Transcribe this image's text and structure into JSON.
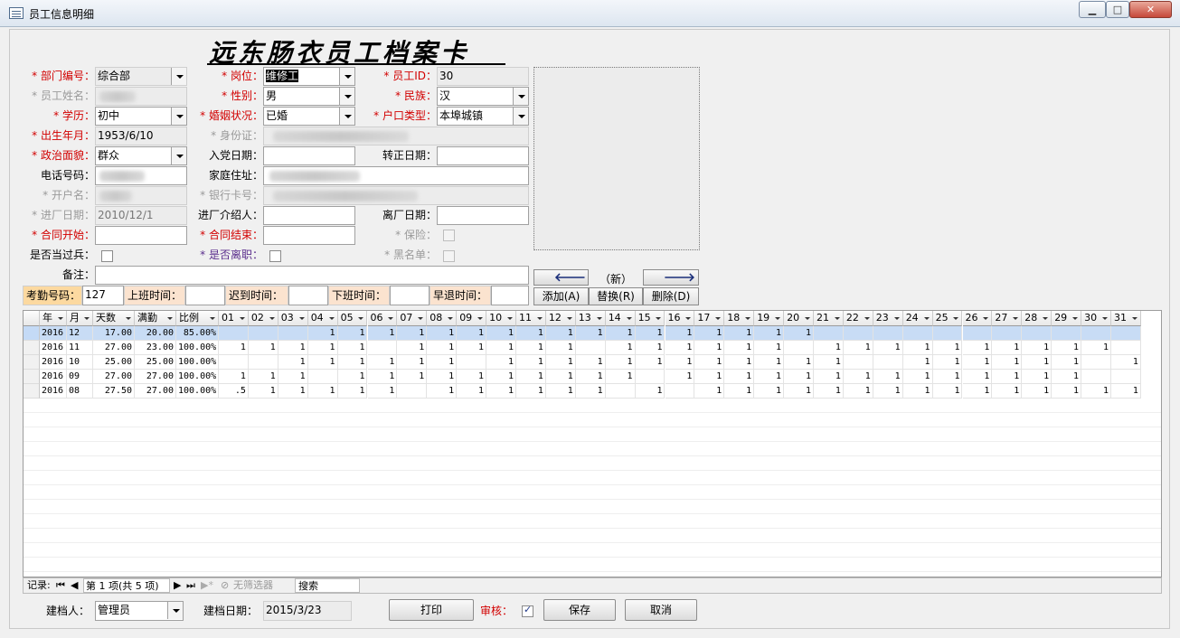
{
  "window": {
    "title": "员工信息明细",
    "min": "▁",
    "max": "□",
    "close": "✕"
  },
  "form_title": "远东肠衣员工档案卡",
  "fields": {
    "dept": {
      "label": "* 部门编号：",
      "value": "综合部"
    },
    "position": {
      "label": "* 岗位：",
      "value": "维修工"
    },
    "emp_id": {
      "label": "* 员工ID：",
      "value": "30"
    },
    "name": {
      "label": "* 员工姓名："
    },
    "gender": {
      "label": "* 性别：",
      "value": "男"
    },
    "ethnic": {
      "label": "* 民族：",
      "value": "汉"
    },
    "edu": {
      "label": "* 学历：",
      "value": "初中"
    },
    "marital": {
      "label": "* 婚姻状况：",
      "value": "已婚"
    },
    "hukou": {
      "label": "* 户口类型：",
      "value": "本埠城镇"
    },
    "birth": {
      "label": "* 出生年月：",
      "value": "1953/6/10"
    },
    "idcard": {
      "label": "* 身份证："
    },
    "politics": {
      "label": "* 政治面貌：",
      "value": "群众"
    },
    "party_date": {
      "label": "入党日期：",
      "value": ""
    },
    "regular_date": {
      "label": "转正日期：",
      "value": ""
    },
    "phone": {
      "label": "电话号码："
    },
    "address": {
      "label": "家庭住址："
    },
    "account_name": {
      "label": "* 开户名："
    },
    "bank_card": {
      "label": "* 银行卡号："
    },
    "entry_date": {
      "label": "* 进厂日期：",
      "value": "2010/12/1"
    },
    "referrer": {
      "label": "进厂介绍人：",
      "value": ""
    },
    "leave_date": {
      "label": "离厂日期：",
      "value": ""
    },
    "contract_start": {
      "label": "* 合同开始：",
      "value": ""
    },
    "contract_end": {
      "label": "* 合同结束：",
      "value": ""
    },
    "insurance": {
      "label": "* 保险："
    },
    "soldier": {
      "label": "是否当过兵："
    },
    "resigned": {
      "label": "* 是否离职："
    },
    "blacklist": {
      "label": "* 黑名单："
    },
    "remark": {
      "label": "备注：",
      "value": ""
    }
  },
  "attendance": {
    "code_label": "考勤号码：",
    "code_value": "127",
    "on_label": "上班时间：",
    "late_label": "迟到时间：",
    "off_label": "下班时间：",
    "early_label": "早退时间："
  },
  "photo_nav": {
    "prev": "🡐",
    "new_label": "（新）",
    "next": "🡒",
    "add": "添加(A)",
    "replace": "替换(R)",
    "delete": "删除(D)"
  },
  "table": {
    "headers": [
      "年",
      "月",
      "天数",
      "满勤",
      "比例",
      "01",
      "02",
      "03",
      "04",
      "05",
      "06",
      "07",
      "08",
      "09",
      "10",
      "11",
      "12",
      "13",
      "14",
      "15",
      "16",
      "17",
      "18",
      "19",
      "20",
      "21",
      "22",
      "23",
      "24",
      "25",
      "26",
      "27",
      "28",
      "29",
      "30",
      "31"
    ],
    "rows": [
      [
        "2016",
        "12",
        "17.00",
        "20.00",
        "85.00%",
        "",
        "",
        "",
        "1",
        "1",
        "1",
        "1",
        "1",
        "1",
        "1",
        "1",
        "1",
        "1",
        "1",
        "1",
        "1",
        "1",
        "1",
        "1",
        "1",
        "",
        "",
        "",
        "",
        "",
        "",
        "",
        "",
        "",
        "",
        ""
      ],
      [
        "2016",
        "11",
        "27.00",
        "23.00",
        "100.00%",
        "1",
        "1",
        "1",
        "1",
        "1",
        "",
        "1",
        "1",
        "1",
        "1",
        "1",
        "1",
        "",
        "1",
        "1",
        "1",
        "1",
        "1",
        "1",
        "",
        "1",
        "1",
        "1",
        "1",
        "1",
        "1",
        "1",
        "1",
        "1",
        "1",
        ""
      ],
      [
        "2016",
        "10",
        "25.00",
        "25.00",
        "100.00%",
        "",
        "",
        "1",
        "1",
        "1",
        "1",
        "1",
        "1",
        "",
        "1",
        "1",
        "1",
        "1",
        "1",
        "1",
        "1",
        "1",
        "1",
        "1",
        "1",
        "1",
        "",
        "",
        "1",
        "1",
        "1",
        "1",
        "1",
        "1",
        "",
        "1"
      ],
      [
        "2016",
        "09",
        "27.00",
        "27.00",
        "100.00%",
        "1",
        "1",
        "1",
        "",
        "1",
        "1",
        "1",
        "1",
        "1",
        "1",
        "1",
        "1",
        "1",
        "1",
        "",
        "1",
        "1",
        "1",
        "1",
        "1",
        "1",
        "1",
        "1",
        "1",
        "1",
        "1",
        "1",
        "1",
        "1",
        "",
        ""
      ],
      [
        "2016",
        "08",
        "27.50",
        "27.00",
        "100.00%",
        ".5",
        "1",
        "1",
        "1",
        "1",
        "1",
        "",
        "1",
        "1",
        "1",
        "1",
        "1",
        "1",
        "",
        "1",
        "",
        "1",
        "1",
        "1",
        "1",
        "1",
        "1",
        "1",
        "1",
        "1",
        "1",
        "1",
        "1",
        "1",
        "1",
        "1"
      ]
    ]
  },
  "record_nav": {
    "label": "记录:",
    "first": "⏮",
    "prev": "◀",
    "position": "第 1 项(共 5 项)",
    "next": "▶",
    "last": "⏭",
    "new": "▶*",
    "filter": "无筛选器",
    "search": "搜索"
  },
  "footer": {
    "creator_label": "建档人：",
    "creator_value": "管理员",
    "date_label": "建档日期：",
    "date_value": "2015/3/23",
    "print": "打印",
    "audit_label": "审核：",
    "save": "保存",
    "cancel": "取消"
  }
}
